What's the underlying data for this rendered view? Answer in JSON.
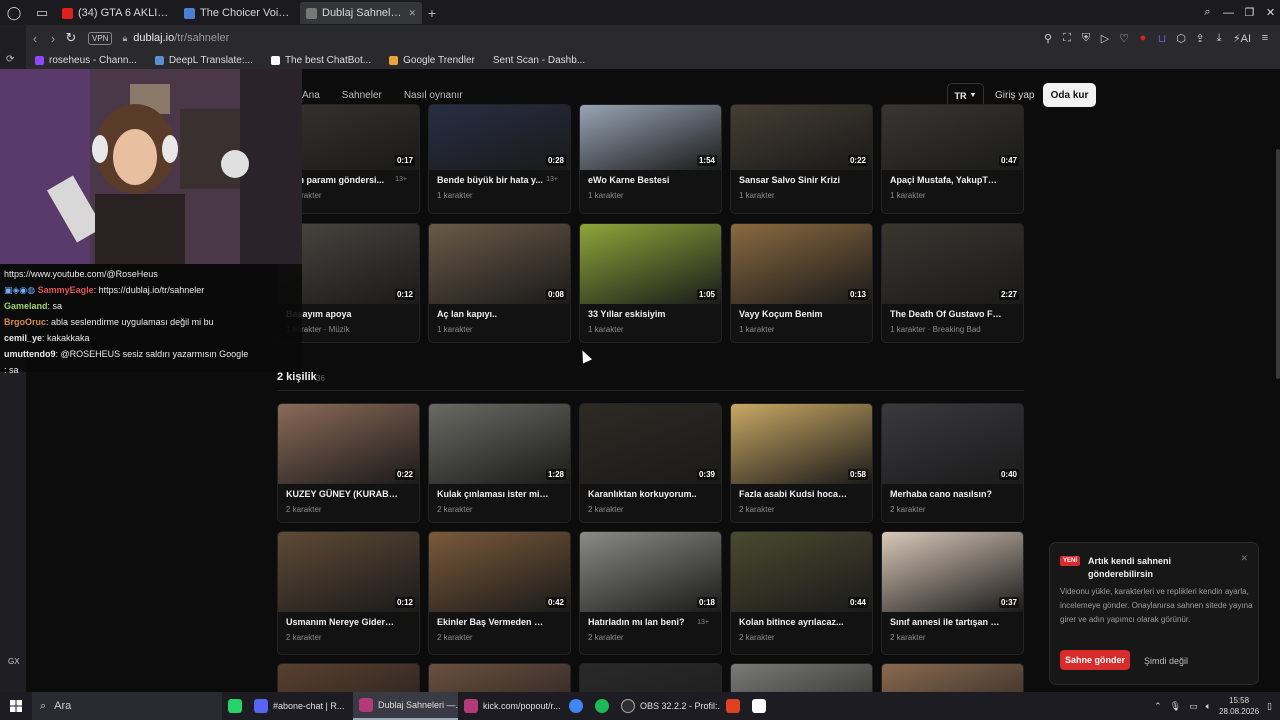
{
  "browser": {
    "tabs": [
      {
        "label": "(34) GTA 6 AKLIMI ALDI! İ...",
        "color": "#e02020"
      },
      {
        "label": "The Choicer Voicer - Play G...",
        "color": "#4a7fd4"
      },
      {
        "label": "Dublaj Sahneleri — Sesien...",
        "color": "#555"
      }
    ],
    "url_domain": "dublaj.io",
    "url_path": "/tr/sahneler",
    "vpn_label": "VPN",
    "bookmarks": [
      {
        "label": "roseheus - Chann...",
        "color": "#9146ff"
      },
      {
        "label": "DeepL Translate:...",
        "color": "#0f2b46"
      },
      {
        "label": "The best ChatBot...",
        "color": "#ffffff"
      },
      {
        "label": "Google Trendler",
        "color": "#e8a33d"
      },
      {
        "label": "Sent Scan - Dashb...",
        "color": "#2a2a2e"
      }
    ]
  },
  "site": {
    "nav_links": [
      "Ana",
      "Sahneler",
      "Nasıl oynanır"
    ],
    "lang": "TR",
    "login": "Giriş yap",
    "cta": "Oda kur"
  },
  "cards_row1": [
    {
      "title": "...im paramı göndersi...",
      "meta": "1 karakter",
      "dur": "0:17",
      "age": "13+",
      "bg": "#3a3530"
    },
    {
      "title": "Bende büyük bir hata y...",
      "meta": "1 karakter",
      "dur": "0:28",
      "age": "13+",
      "bg": "#2a3048"
    },
    {
      "title": "eWo Karne Bestesi",
      "meta": "1 karakter",
      "dur": "1:54",
      "age": "",
      "bg": "#a9b6c8"
    },
    {
      "title": "Sansar Salvo Sinir Krizi",
      "meta": "1 karakter",
      "dur": "0:22",
      "age": "",
      "bg": "#4a4236"
    },
    {
      "title": "Apaçi Mustafa, YakupTV'ye sa...",
      "meta": "1 karakter",
      "dur": "0:47",
      "age": "",
      "bg": "#3c3a35"
    }
  ],
  "cards_row2": [
    {
      "title": "Basayım apoya",
      "meta": "1 karakter · Müzik",
      "dur": "0:12",
      "age": "",
      "bg": "#4a4540"
    },
    {
      "title": "Aç lan kapıyı..",
      "meta": "1 karakter",
      "dur": "0:08",
      "age": "",
      "bg": "#6a5a48"
    },
    {
      "title": "33 Yıllar eskisiyim",
      "meta": "1 karakter",
      "dur": "1:05",
      "age": "",
      "bg": "#8fa53a"
    },
    {
      "title": "Vayy Koçum Benim",
      "meta": "1 karakter",
      "dur": "0:13",
      "age": "",
      "bg": "#8a6a40"
    },
    {
      "title": "The Death Of Gustavo Fring",
      "meta": "1 karakter · Breaking Bad",
      "dur": "2:27",
      "age": "",
      "bg": "#3a3530"
    }
  ],
  "section": {
    "title": "2 kişilik",
    "count": "36"
  },
  "cards_row3": [
    {
      "title": "KUZEY GÜNEY (KURABİYE VA...",
      "meta": "2 karakter",
      "dur": "0:22",
      "age": "",
      "bg": "#8a6a58"
    },
    {
      "title": "Kulak çınlaması ister misin ho...",
      "meta": "2 karakter",
      "dur": "1:28",
      "age": "",
      "bg": "#6a6a64"
    },
    {
      "title": "Karanlıktan korkuyorum..",
      "meta": "2 karakter",
      "dur": "0:39",
      "age": "",
      "bg": "#2e2a24"
    },
    {
      "title": "Fazla asabi Kudsi hocayla \"NE...",
      "meta": "2 karakter",
      "dur": "0:58",
      "age": "",
      "bg": "#c9a864"
    },
    {
      "title": "Merhaba cano nasılsın?",
      "meta": "2 karakter",
      "dur": "0:40",
      "age": "",
      "bg": "#3a3a3e"
    }
  ],
  "cards_row4": [
    {
      "title": "Usmanım Nereye Gidersin",
      "meta": "2 karakter",
      "dur": "0:12",
      "age": "",
      "bg": "#5e4a36"
    },
    {
      "title": "Ekinler Baş Vermeden Kör Buz...",
      "meta": "2 karakter",
      "dur": "0:42",
      "age": "",
      "bg": "#7a5a3a"
    },
    {
      "title": "Hatırladın mı lan beni?",
      "meta": "2 karakter",
      "dur": "0:18",
      "age": "13+",
      "bg": "#8a8a88"
    },
    {
      "title": "Kolan bitince ayrılacaz...",
      "meta": "2 karakter",
      "dur": "0:44",
      "age": "",
      "bg": "#4a4a30"
    },
    {
      "title": "Sınıf annesi ile tartışan çocuk",
      "meta": "2 karakter",
      "dur": "0:37",
      "age": "",
      "bg": "#d8c8b8"
    }
  ],
  "cards_row5_bg": [
    "#5a4030",
    "#6a5040",
    "#2a2a2a",
    "#7a7a78",
    "#8a6a50"
  ],
  "toast": {
    "badge": "YENİ",
    "title": "Artık kendi sahneni gönderebilirsin",
    "body": "Videonu yükle, karakterleri ve replikleri kendin ayarla, incelemeye gönder. Onaylanırsa sahnen sitede yayına girer ve adın yapımcı olarak görünür.",
    "primary": "Sahne gönder",
    "secondary": "Şimdi değil"
  },
  "chat": [
    {
      "user": "",
      "text": "https://www.youtube.com/@RoseHeus",
      "color": "#cfcfcf"
    },
    {
      "user": "SammyEagle",
      "text": ": https://dublaj.io/tr/sahneler",
      "color": "#e05555"
    },
    {
      "user": "Gameland",
      "text": ": sa",
      "color": "#9ad36a"
    },
    {
      "user": "BrgoOruc",
      "text": ": abla seslendirme uygulaması değil mi bu",
      "color": "#d98a4a"
    },
    {
      "user": "cemil_ye",
      "text": ": kakakkaka",
      "color": "#ffffff"
    },
    {
      "user": "umuttendo9",
      "text": ": @ROSEHEUS sesiz saldırı yazarmısın Google",
      "color": "#ffffff"
    },
    {
      "user": "",
      "text": ": sa",
      "color": "#ffffff"
    }
  ],
  "overlay_gx": "GX",
  "taskbar": {
    "search": "Ara",
    "items": [
      {
        "label": "",
        "color": "#25d366"
      },
      {
        "label": "#abone-chat | R...",
        "color": "#5865f2"
      },
      {
        "label": "Dublaj Sahneleri —...",
        "color": "#b33a7a"
      },
      {
        "label": "kick.com/popout/r...",
        "color": "#b33a7a"
      },
      {
        "label": "",
        "color": "#4285f4"
      },
      {
        "label": "",
        "color": "#1db954"
      },
      {
        "label": "OBS 32.2.2 - Profil:...",
        "color": "#302e31"
      },
      {
        "label": "",
        "color": "#e04020"
      },
      {
        "label": "",
        "color": "#ffffff"
      }
    ],
    "time": "15:58",
    "date": "28.08.2026"
  }
}
